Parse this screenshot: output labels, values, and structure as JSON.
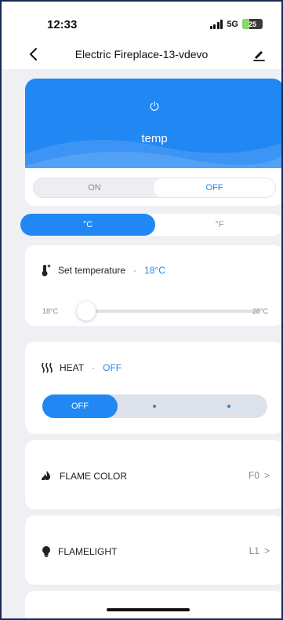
{
  "status_bar": {
    "time": "12:33",
    "network": "5G",
    "battery": "25"
  },
  "nav": {
    "title": "Electric Fireplace-13-vdevo",
    "back_icon": "chevron-left-icon",
    "edit_icon": "pencil-icon"
  },
  "hero": {
    "title": "temp",
    "icon": "power-icon"
  },
  "power_toggle": {
    "on_label": "ON",
    "off_label": "OFF",
    "selected": "OFF"
  },
  "unit_toggle": {
    "celsius_label": "°C",
    "fahrenheit_label": "°F",
    "selected": "°C"
  },
  "temperature": {
    "label": "Set temperature",
    "separator": "·",
    "value": "18°C",
    "min_label": "18°C",
    "max_label": "28°C",
    "level_fraction": 0
  },
  "heat": {
    "label": "HEAT",
    "separator": "·",
    "value": "OFF",
    "options": [
      "OFF",
      "",
      ""
    ],
    "selected_index": 0
  },
  "flame_color": {
    "label": "FLAME COLOR",
    "value": "F0",
    "chevron": ">"
  },
  "flamelight": {
    "label": "FLAMELIGHT",
    "value": "L1",
    "chevron": ">"
  },
  "colors": {
    "accent": "#2187f3",
    "background": "#eef0f4",
    "card": "#ffffff"
  }
}
